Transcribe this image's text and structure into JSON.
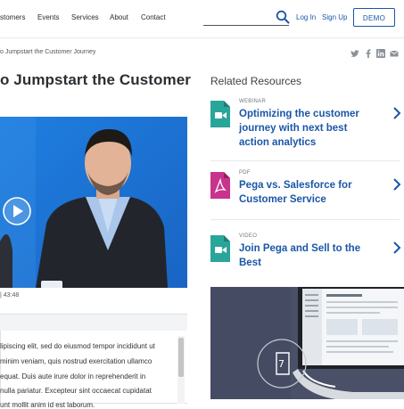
{
  "header": {
    "nav": [
      "stomers",
      "Events",
      "Services",
      "About",
      "Contact"
    ],
    "login": "Log In",
    "signup": "Sign Up",
    "demo": "DEMO"
  },
  "breadcrumb": "o Jumpstart the Customer Journey",
  "title": "o Jumpstart the Customer",
  "video": {
    "meta": "| 43:48"
  },
  "body_lines": [
    "lipiscing elit, sed do eiusmod tempor incididunt ut",
    "minim veniam, quis nostrud exercitation ullamco",
    "equat. Duis aute irure dolor in reprehenderit in",
    "nulla pariatur. Excepteur sint occaecat cupidatat",
    "unt mollit anim id est laborum."
  ],
  "related": {
    "title": "Related Resources",
    "items": [
      {
        "type": "WEBINAR",
        "icon": "video-file-icon",
        "title_lines": [
          "Optimizing the customer",
          "journey with next best",
          "action analytics"
        ]
      },
      {
        "type": "PDF",
        "icon": "pdf-file-icon",
        "title_lines": [
          "Pega vs. Salesforce for",
          "Customer Service"
        ]
      },
      {
        "type": "VIDEO",
        "icon": "video-file-icon",
        "title_lines": [
          "Join Pega and Sell to the",
          "Best"
        ]
      }
    ]
  },
  "promo": {
    "badge": "7"
  },
  "colors": {
    "accent": "#1a56a8",
    "video_icon": "#2aa59a",
    "pdf_icon": "#c8338e"
  }
}
